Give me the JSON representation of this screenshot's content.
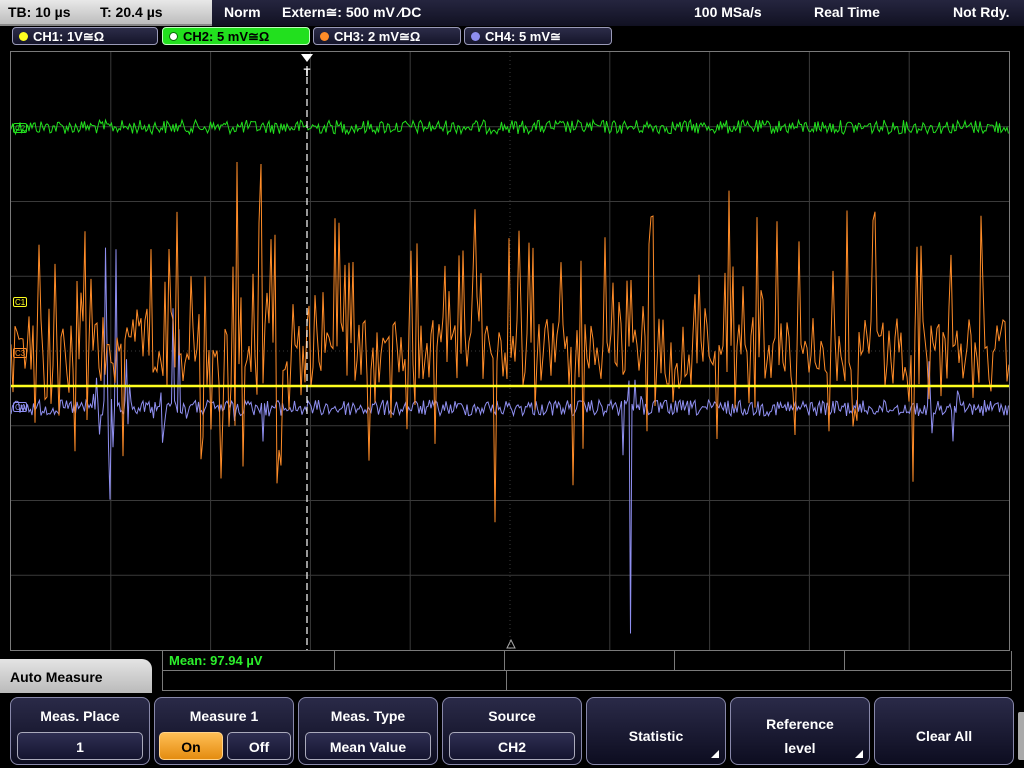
{
  "topbar": {
    "tb": "TB: 10 µs",
    "t": "T: 20.4 µs",
    "mode": "Norm",
    "trigger": "Extern≅: 500 mV ⁄DC",
    "sample_rate": "100 MSa/s",
    "acq_mode": "Real Time",
    "status": "Not Rdy."
  },
  "channels": [
    {
      "label": "CH1: 1V≅Ω",
      "color": "#ffff20",
      "active": false
    },
    {
      "label": "CH2: 5 mV≅Ω",
      "color": "#22e01e",
      "active": true
    },
    {
      "label": "CH3: 2 mV≅Ω",
      "color": "#ff8c28",
      "active": false
    },
    {
      "label": "CH4: 5 mV≅",
      "color": "#8f8ff0",
      "active": false
    }
  ],
  "markers": {
    "c2": "C2",
    "c1": "C1",
    "c3": "C3",
    "c4": "C4",
    "trigger": "T"
  },
  "measurement": {
    "mean": "Mean: 97.94 µV"
  },
  "menu": {
    "title": "Auto Measure",
    "meas_place": {
      "label": "Meas. Place",
      "value": "1"
    },
    "measure1": {
      "label": "Measure 1",
      "on": "On",
      "off": "Off"
    },
    "meas_type": {
      "label": "Meas. Type",
      "value": "Mean Value"
    },
    "source": {
      "label": "Source",
      "value": "CH2"
    },
    "statistic": "Statistic",
    "reference": {
      "line1": "Reference",
      "line2": "level"
    },
    "clear_all": "Clear All"
  },
  "colors": {
    "ch1": "#ffff20",
    "ch2": "#22e01e",
    "ch3": "#ff8c28",
    "ch4": "#8f8ff0",
    "grid": "#3a3a3a"
  }
}
